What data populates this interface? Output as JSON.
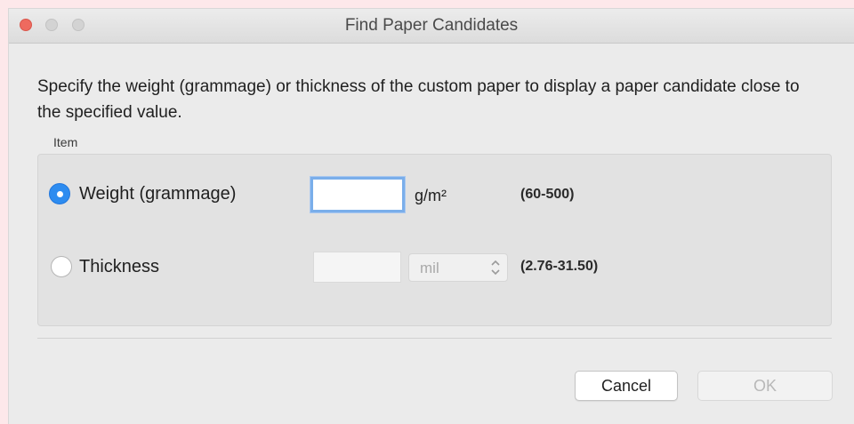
{
  "window": {
    "title": "Find Paper Candidates"
  },
  "instructions": "Specify the weight (grammage) or thickness of the custom paper to display a paper candidate close to the specified value.",
  "item_group": {
    "label": "Item",
    "weight": {
      "label": "Weight (grammage)",
      "selected": true,
      "value": "",
      "unit": "g/m²",
      "range": "(60-500)"
    },
    "thickness": {
      "label": "Thickness",
      "selected": false,
      "value": "",
      "unit_select": "mil",
      "range": "(2.76-31.50)"
    }
  },
  "buttons": {
    "cancel": "Cancel",
    "ok": "OK"
  },
  "colors": {
    "accent": "#2d8cf0",
    "close_button": "#ee6a5f",
    "page_background": "#fde8ea"
  },
  "icons": {
    "close": "close-dot-icon",
    "minimize": "minimize-dot-icon",
    "maximize": "maximize-dot-icon",
    "stepper": "chevron-up-down-icon"
  }
}
